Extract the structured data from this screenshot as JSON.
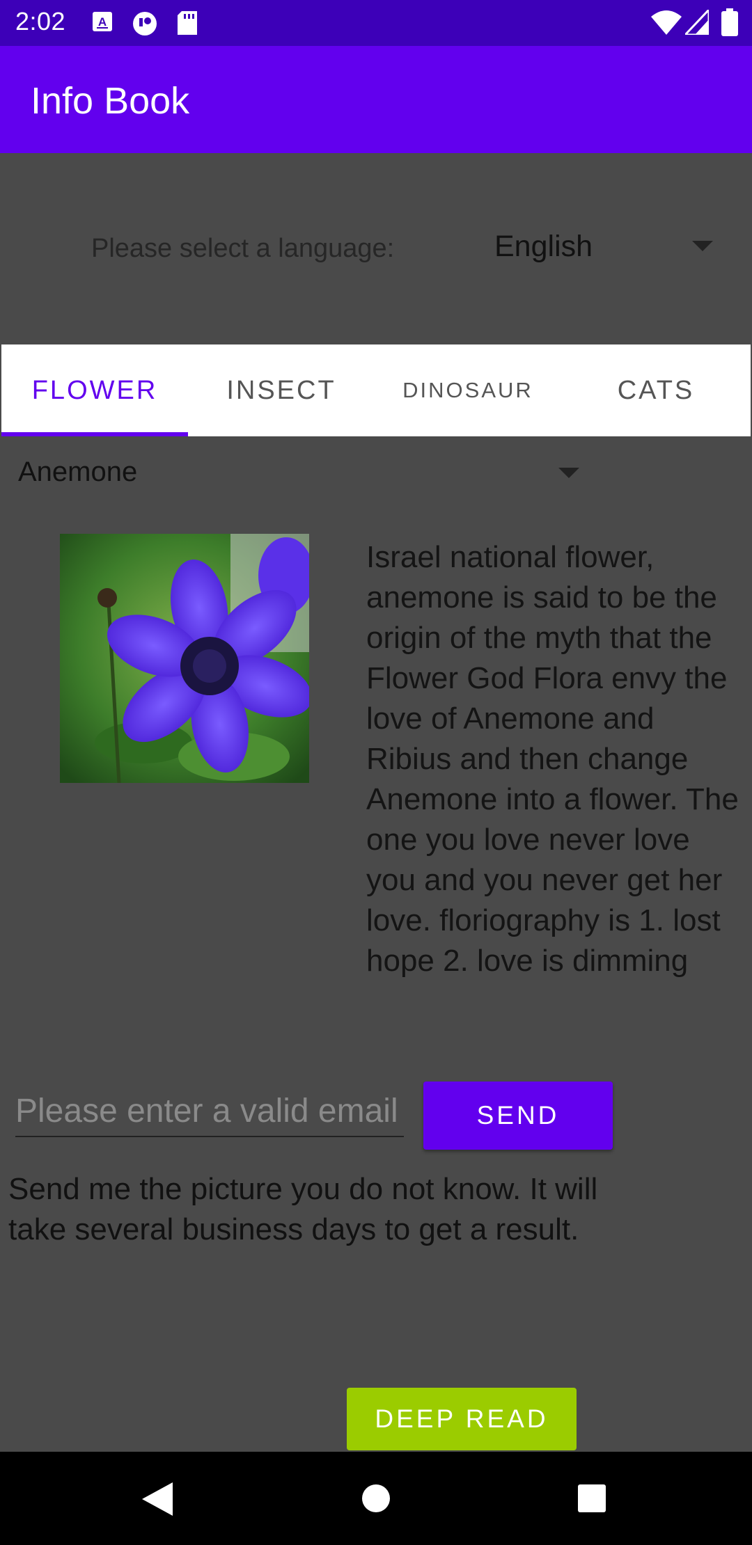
{
  "status_bar": {
    "time": "2:02",
    "left_icons": [
      "keyboard-a-icon",
      "media-icon",
      "sd-card-icon"
    ],
    "right_icons": [
      "wifi-icon",
      "signal-icon",
      "battery-icon"
    ]
  },
  "app_bar": {
    "title": "Info Book"
  },
  "language": {
    "label": "Please select a language:",
    "selected": "English"
  },
  "tabs": [
    {
      "label": "FLOWER",
      "active": true
    },
    {
      "label": "INSECT",
      "active": false
    },
    {
      "label": "DINOSAUR",
      "active": false
    },
    {
      "label": "CATS",
      "active": false
    }
  ],
  "item_select": {
    "selected": "Anemone"
  },
  "content": {
    "image_subject": "purple anemone flower",
    "description": "Israel national flower, anemone is said to be the origin of the myth that the Flower God Flora envy the love of Anemone and Ribius and then change Anemone into a flower. The one you love never love you and you never get her love. floriography is 1. lost hope 2. love is dimming"
  },
  "email": {
    "placeholder": "Please enter a valid email",
    "value": ""
  },
  "send_label": "SEND",
  "info_text": "Send me the picture you do not know. It will take several business days to get a result.",
  "deep_read_label": "DEEP READ",
  "nav_bar": {
    "buttons": [
      "back-icon",
      "home-icon",
      "recents-icon"
    ]
  },
  "colors": {
    "status_bar": "#3d00b8",
    "primary": "#6200ee",
    "background": "#4a4a4a",
    "deep_read": "#9bcc00"
  }
}
